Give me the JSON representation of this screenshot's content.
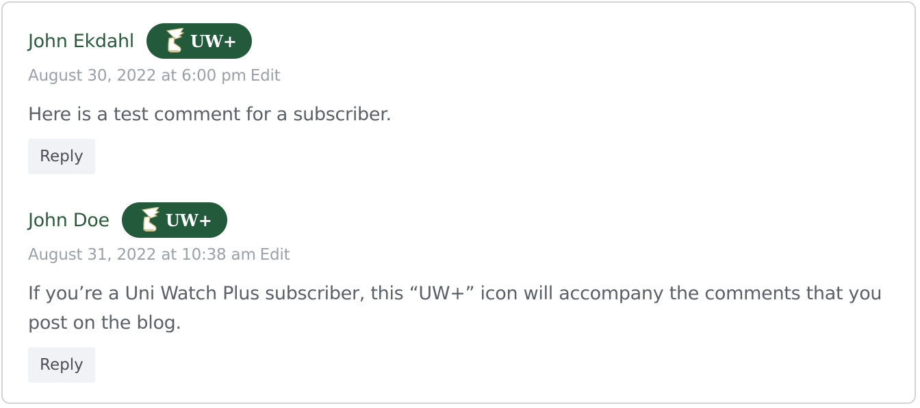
{
  "comments": [
    {
      "author": "John Ekdahl",
      "badge_label": "UW+",
      "date": "August 30, 2022 at 6:00 pm",
      "edit_label": "Edit",
      "text": "Here is a test comment for a subscriber.",
      "reply_label": "Reply"
    },
    {
      "author": "John Doe",
      "badge_label": "UW+",
      "date": "August 31, 2022 at 10:38 am",
      "edit_label": "Edit",
      "text": "If you’re a Uni Watch Plus subscriber, this “UW+” icon will accompany the comments that you post on the blog.",
      "reply_label": "Reply"
    }
  ],
  "colors": {
    "author": "#2a5b3a",
    "badge_bg": "#235a3c",
    "meta": "#9aa0a8",
    "body_text": "#5b6068",
    "reply_bg": "#f0f2f5"
  },
  "icons": {
    "badge_icon": "winged-shoe-icon"
  }
}
